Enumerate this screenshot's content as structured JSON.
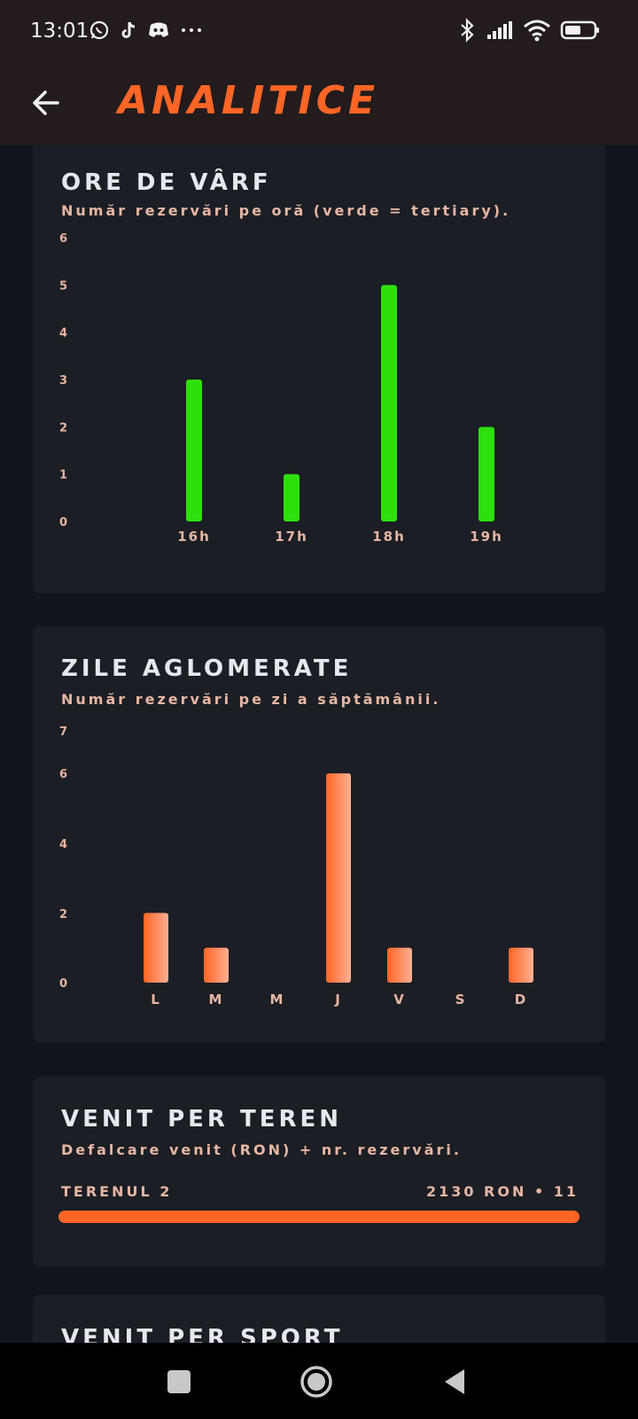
{
  "status_bar": {
    "time": "13:01",
    "left_icons": [
      "whatsapp-icon",
      "tiktok-icon",
      "discord-icon",
      "more-dots-icon"
    ],
    "right_icons": [
      "bluetooth-icon",
      "signal-icon",
      "wifi-icon",
      "battery-icon"
    ]
  },
  "app_bar": {
    "title": "ANALITICE",
    "accent_color": "#ff6525"
  },
  "peak_hours": {
    "title": "ORE DE VÂRF",
    "subtitle": "Număr rezervări pe oră (verde = tertiary).",
    "bar_color": "#2de00c"
  },
  "busy_days": {
    "title": "ZILE AGLOMERATE",
    "subtitle": "Număr rezervări pe zi a săptămânii.",
    "bar_color_start": "#ff6525",
    "bar_color_end": "#ffb094"
  },
  "revenue_per_court": {
    "title": "VENIT PER TEREN",
    "subtitle": "Defalcare venit (RON) + nr. rezervări.",
    "rows": [
      {
        "label": "TERENUL 2",
        "value": "2130 RON • 11",
        "fraction": 1.0
      }
    ]
  },
  "revenue_per_sport": {
    "title": "VENIT PER SPORT"
  },
  "chart_data": [
    {
      "type": "bar",
      "title": "ORE DE VÂRF",
      "categories": [
        "16h",
        "17h",
        "18h",
        "19h"
      ],
      "values": [
        3,
        1,
        5,
        2
      ],
      "y_ticks": [
        "6",
        "5",
        "4",
        "3",
        "2",
        "1",
        "0"
      ],
      "ylim": [
        0,
        6
      ],
      "grid": false
    },
    {
      "type": "bar",
      "title": "ZILE AGLOMERATE",
      "categories": [
        "L",
        "M",
        "M",
        "J",
        "V",
        "S",
        "D"
      ],
      "values": [
        2,
        1,
        0,
        6,
        1,
        0,
        1
      ],
      "y_ticks": [
        "7",
        "6",
        "4",
        "2",
        "0"
      ],
      "ylim": [
        0,
        7
      ],
      "grid": false
    }
  ],
  "nav_bar": {
    "buttons": [
      "recents-button",
      "home-button",
      "back-button"
    ]
  }
}
